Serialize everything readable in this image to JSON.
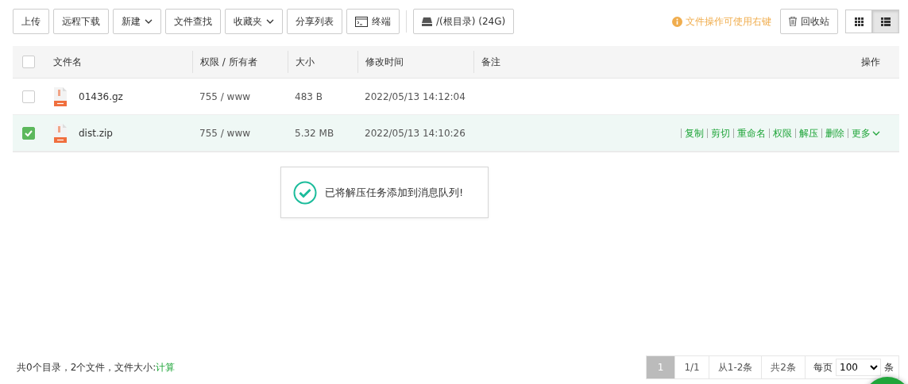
{
  "toolbar": {
    "buttons": [
      {
        "label": "上传",
        "kind": "plain"
      },
      {
        "label": "远程下载",
        "kind": "plain"
      },
      {
        "label": "新建",
        "kind": "dropdown"
      },
      {
        "label": "文件查找",
        "kind": "plain"
      },
      {
        "label": "收藏夹",
        "kind": "dropdown"
      },
      {
        "label": "分享列表",
        "kind": "plain"
      },
      {
        "label": "终端",
        "kind": "terminal"
      }
    ],
    "path_button": "/(根目录) (24G)",
    "hint": "文件操作可使用右键",
    "recycle_button": "回收站",
    "view_modes": [
      {
        "kind": "grid",
        "selected": false
      },
      {
        "kind": "list",
        "selected": true
      }
    ]
  },
  "table": {
    "select_all": false,
    "columns": [
      "文件名",
      "权限 / 所有者",
      "大小",
      "修改时间",
      "备注",
      "操作"
    ],
    "rows": [
      {
        "checked": false,
        "name": "01436.gz",
        "permission": "755 / www",
        "size": "483 B",
        "modified": "2022/05/13 14:12:04",
        "actions": []
      },
      {
        "checked": true,
        "name": "dist.zip",
        "permission": "755 / www",
        "size": "5.32 MB",
        "modified": "2022/05/13 14:10:26",
        "actions": [
          "复制",
          "剪切",
          "重命名",
          "权限",
          "解压",
          "删除"
        ],
        "more": "更多"
      }
    ]
  },
  "toast": {
    "message": "已将解压任务添加到消息队列!"
  },
  "footer": {
    "summary": "共0个目录，2个文件，文件大小: ",
    "calc_link": "计算",
    "pagination": [
      {
        "label": "1",
        "selected": true
      },
      {
        "label": "1/1",
        "selected": false
      },
      {
        "label": "从1-2条",
        "selected": false
      },
      {
        "label": "共2条",
        "selected": false
      }
    ],
    "per_page_label": "每页",
    "per_page": "100",
    "per_page_unit": "条"
  }
}
